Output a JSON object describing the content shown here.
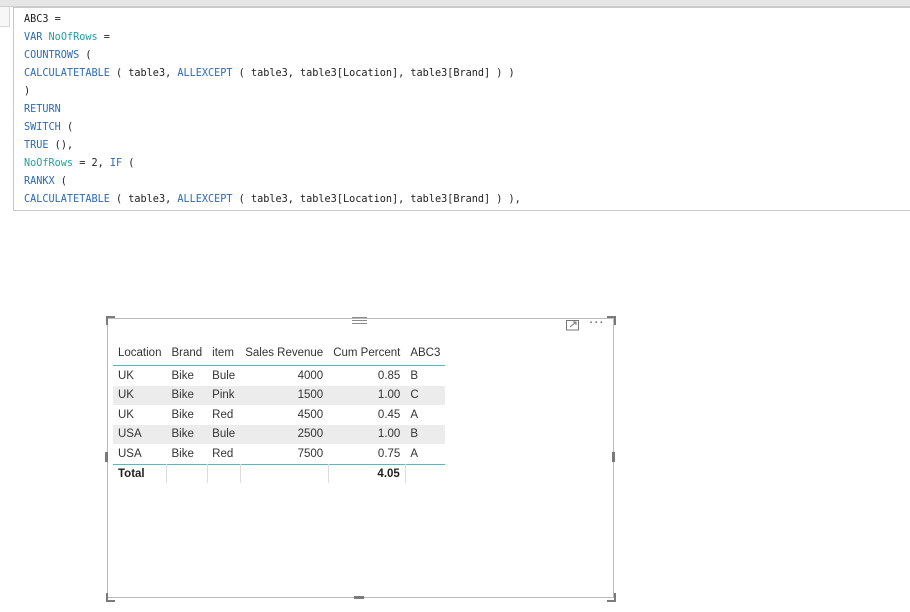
{
  "formula": {
    "lines": [
      [
        {
          "t": "ABC3 =",
          "c": ""
        }
      ],
      [
        {
          "t": "VAR ",
          "c": "kw"
        },
        {
          "t": "NoOfRows",
          "c": "vr"
        },
        {
          "t": " =",
          "c": ""
        }
      ],
      [
        {
          "t": "COUNTROWS",
          "c": "kw"
        },
        {
          "t": " (",
          "c": ""
        }
      ],
      [
        {
          "t": "CALCULATETABLE",
          "c": "kw"
        },
        {
          "t": " ( table3, ",
          "c": ""
        },
        {
          "t": "ALLEXCEPT",
          "c": "kw"
        },
        {
          "t": " ( table3, table3[Location], table3[Brand] ) )",
          "c": ""
        }
      ],
      [
        {
          "t": ")",
          "c": ""
        }
      ],
      [
        {
          "t": "RETURN",
          "c": "kw"
        }
      ],
      [
        {
          "t": "SWITCH",
          "c": "kw"
        },
        {
          "t": " (",
          "c": ""
        }
      ],
      [
        {
          "t": "TRUE",
          "c": "kw"
        },
        {
          "t": " (),",
          "c": ""
        }
      ],
      [
        {
          "t": "NoOfRows",
          "c": "vr"
        },
        {
          "t": " = 2, ",
          "c": ""
        },
        {
          "t": "IF",
          "c": "kw"
        },
        {
          "t": " (",
          "c": ""
        }
      ],
      [
        {
          "t": "RANKX",
          "c": "kw"
        },
        {
          "t": " (",
          "c": ""
        }
      ],
      [
        {
          "t": "CALCULATETABLE",
          "c": "kw"
        },
        {
          "t": " ( table3, ",
          "c": ""
        },
        {
          "t": "ALLEXCEPT",
          "c": "kw"
        },
        {
          "t": " ( table3, table3[Location], table3[Brand] ) ),",
          "c": ""
        }
      ]
    ]
  },
  "table": {
    "headers": [
      "Location",
      "Brand",
      "item",
      "Sales Revenue",
      "Cum Percent",
      "ABC3"
    ],
    "rows": [
      [
        "UK",
        "Bike",
        "Bule",
        "4000",
        "0.85",
        "B"
      ],
      [
        "UK",
        "Bike",
        "Pink",
        "1500",
        "1.00",
        "C"
      ],
      [
        "UK",
        "Bike",
        "Red",
        "4500",
        "0.45",
        "A"
      ],
      [
        "USA",
        "Bike",
        "Bule",
        "2500",
        "1.00",
        "B"
      ],
      [
        "USA",
        "Bike",
        "Red",
        "7500",
        "0.75",
        "A"
      ]
    ],
    "total": {
      "label": "Total",
      "cum_percent": "4.05"
    }
  },
  "visual_header": {
    "focus_icon": "focus-mode-icon",
    "more_icon": "more-options-icon",
    "more_glyph": "···",
    "drag_icon": "drag-handle-icon"
  },
  "colors": {
    "keyword": "#2b6ab6",
    "variable": "#21a0a0",
    "accent_line": "#4fbcc2",
    "alt_row": "#ececec"
  }
}
